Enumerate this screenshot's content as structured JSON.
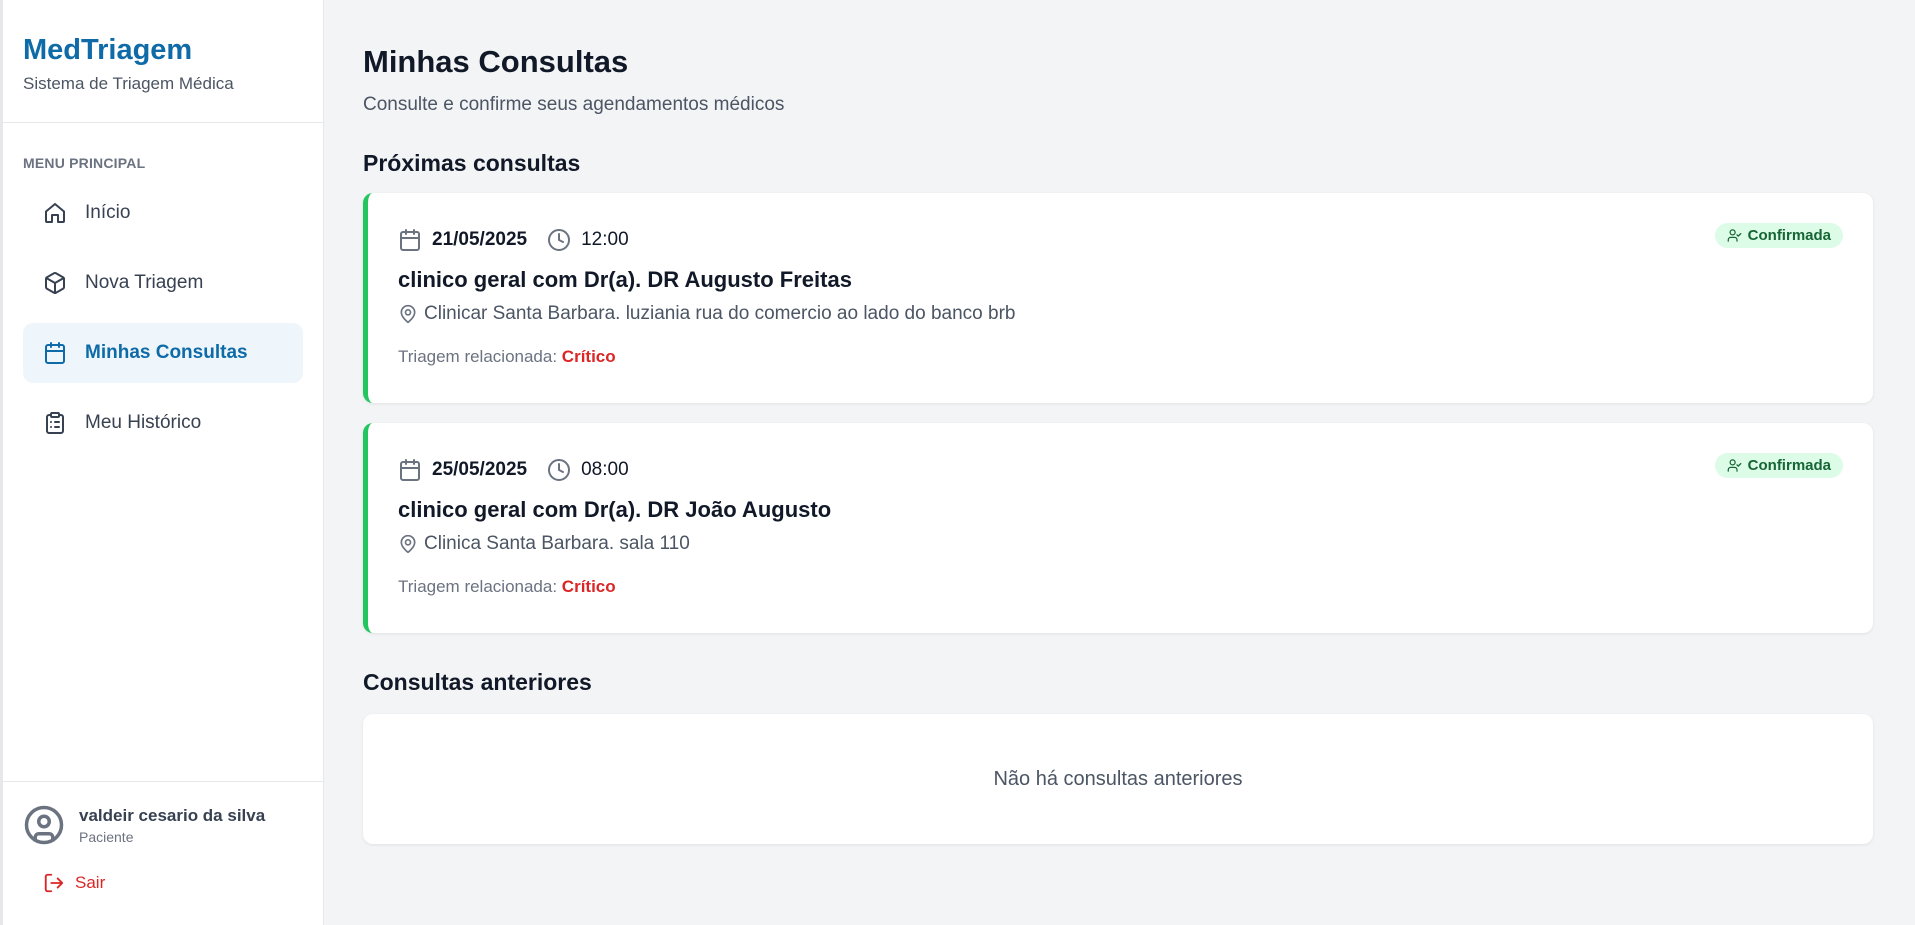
{
  "brand": {
    "name": "MedTriagem",
    "subtitle": "Sistema de Triagem Médica"
  },
  "menu": {
    "title": "MENU PRINCIPAL",
    "items": [
      {
        "label": "Início",
        "icon": "home-icon",
        "active": false
      },
      {
        "label": "Nova Triagem",
        "icon": "box-icon",
        "active": false
      },
      {
        "label": "Minhas Consultas",
        "icon": "calendar-icon",
        "active": true
      },
      {
        "label": "Meu Histórico",
        "icon": "clipboard-icon",
        "active": false
      }
    ]
  },
  "user": {
    "name": "valdeir cesario da silva",
    "role": "Paciente",
    "logout_label": "Sair"
  },
  "page": {
    "title": "Minhas Consultas",
    "subtitle": "Consulte e confirme seus agendamentos médicos"
  },
  "upcoming": {
    "title": "Próximas consultas",
    "appointments": [
      {
        "date": "21/05/2025",
        "time": "12:00",
        "title": "clinico geral com Dr(a). DR Augusto Freitas",
        "location": "Clinicar Santa Barbara. luziania rua do comercio ao lado do banco brb",
        "triage_label": "Triagem relacionada:",
        "triage_level": "Crítico",
        "status": "Confirmada"
      },
      {
        "date": "25/05/2025",
        "time": "08:00",
        "title": "clinico geral com Dr(a). DR João Augusto",
        "location": "Clinica Santa Barbara. sala 110",
        "triage_label": "Triagem relacionada:",
        "triage_level": "Crítico",
        "status": "Confirmada"
      }
    ]
  },
  "past": {
    "title": "Consultas anteriores",
    "empty_message": "Não há consultas anteriores"
  },
  "colors": {
    "brand": "#0e6ba8",
    "confirmed_border": "#22c55e",
    "critical": "#dc2626",
    "badge_bg": "#dcfce7"
  }
}
